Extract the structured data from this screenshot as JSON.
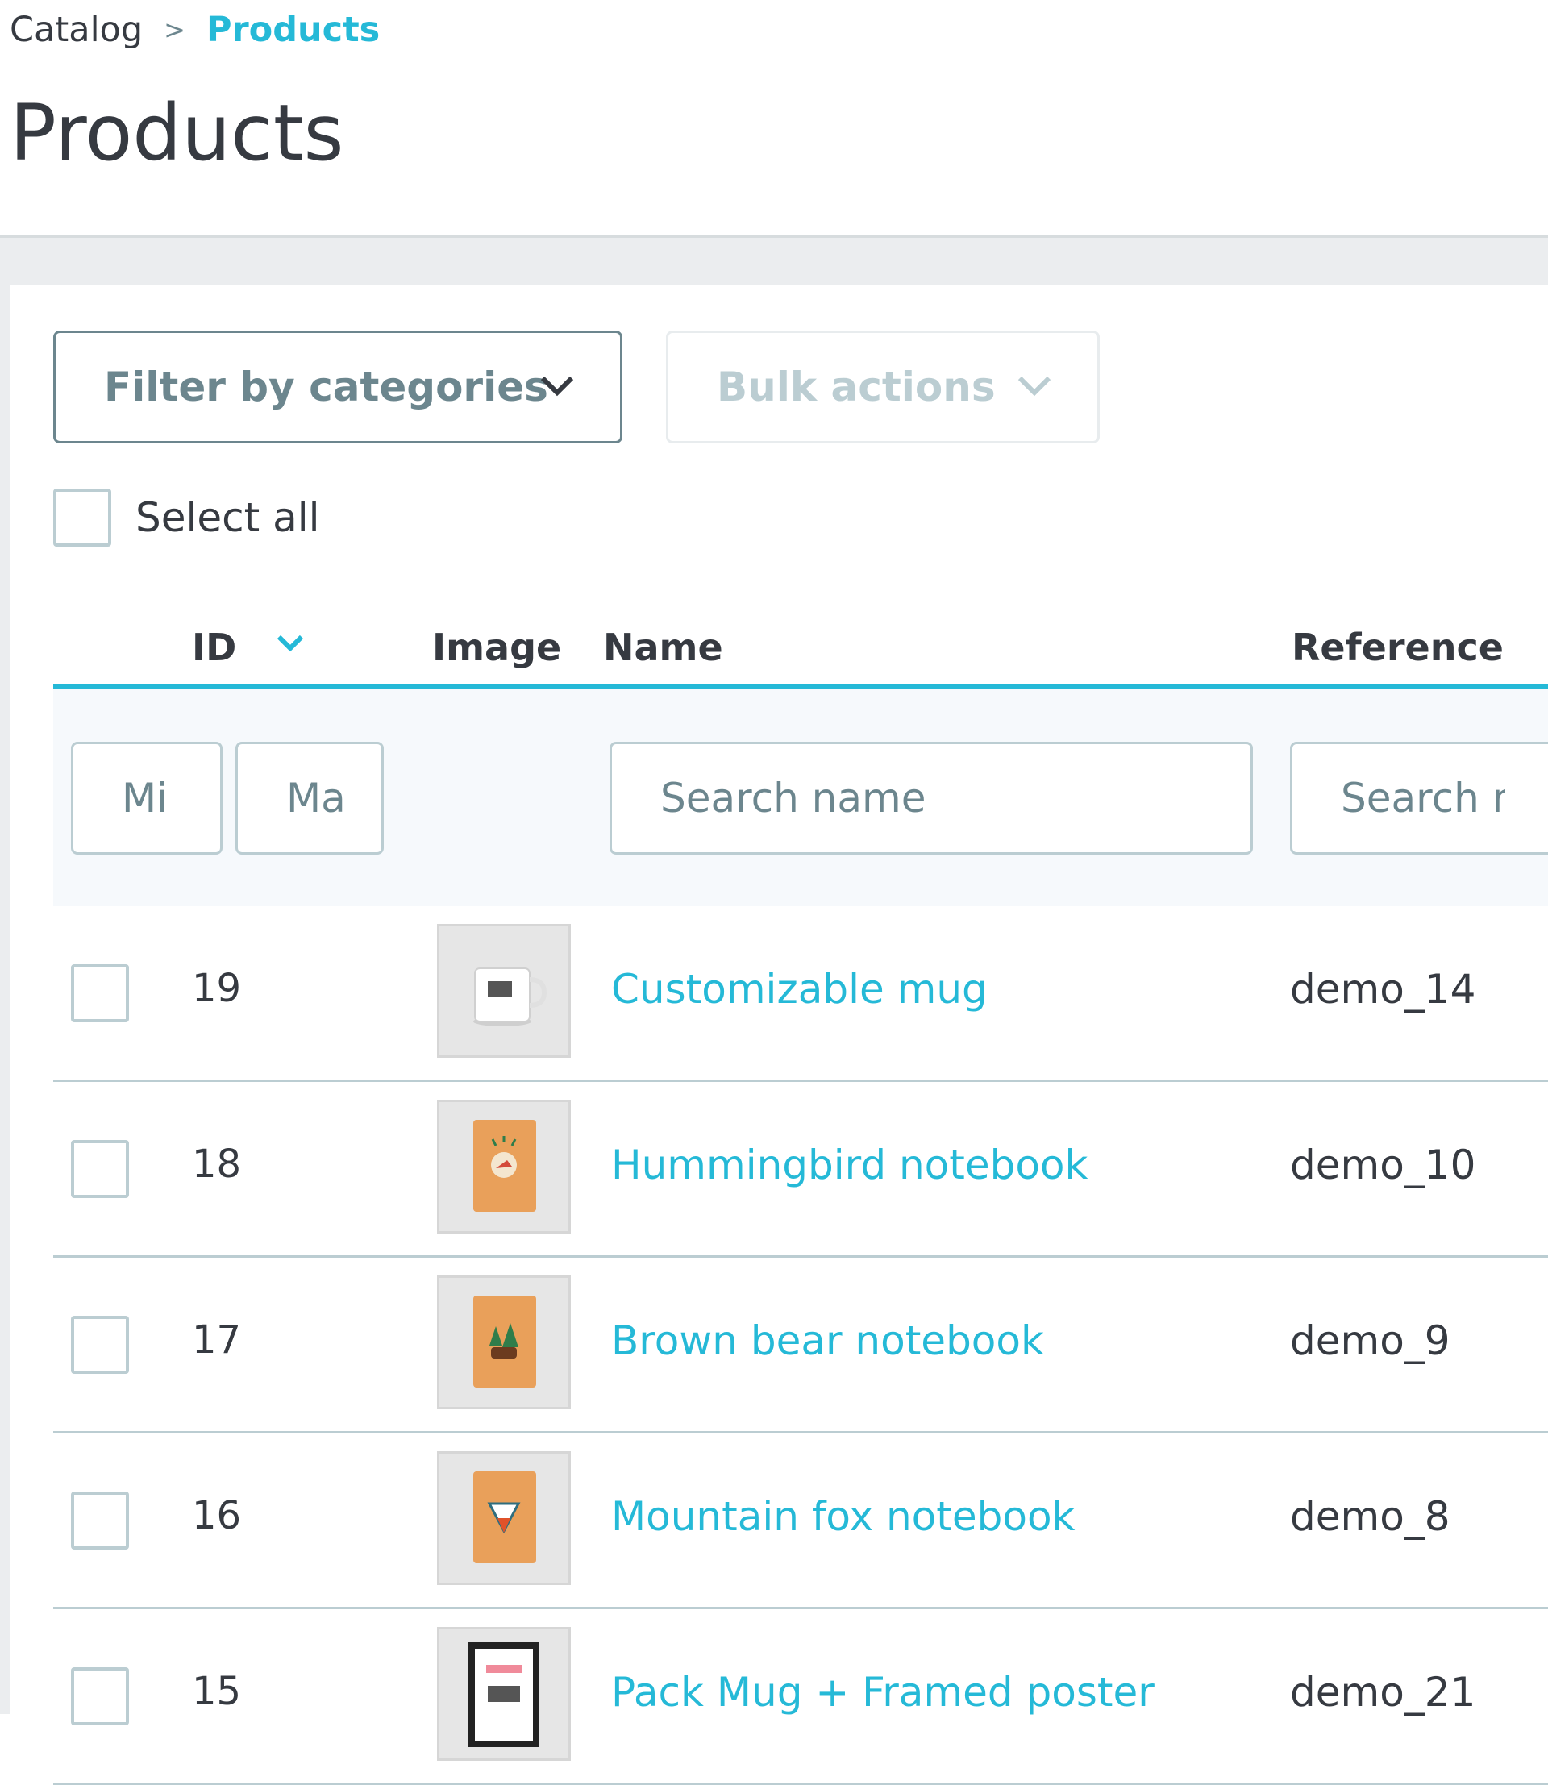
{
  "breadcrumb": {
    "parent": "Catalog",
    "separator": ">",
    "current": "Products"
  },
  "page": {
    "title": "Products"
  },
  "toolbar": {
    "filter_categories_label": "Filter by categories",
    "bulk_actions_label": "Bulk actions",
    "select_all_label": "Select all"
  },
  "table": {
    "columns": {
      "id": "ID",
      "image": "Image",
      "name": "Name",
      "reference": "Reference"
    },
    "filters": {
      "id_min_placeholder": "Mi",
      "id_max_placeholder": "Ma",
      "name_placeholder": "Search name",
      "reference_placeholder": "Search ref."
    },
    "rows": [
      {
        "id": "19",
        "image_icon": "mug-thumbnail",
        "name": "Customizable mug",
        "reference": "demo_14"
      },
      {
        "id": "18",
        "image_icon": "notebook-thumbnail",
        "name": "Hummingbird notebook",
        "reference": "demo_10"
      },
      {
        "id": "17",
        "image_icon": "notebook-thumbnail",
        "name": "Brown bear notebook",
        "reference": "demo_9"
      },
      {
        "id": "16",
        "image_icon": "notebook-thumbnail",
        "name": "Mountain fox notebook",
        "reference": "demo_8"
      },
      {
        "id": "15",
        "image_icon": "poster-thumbnail",
        "name": "Pack Mug + Framed poster",
        "reference": "demo_21"
      }
    ]
  },
  "colors": {
    "accent": "#25b9d7",
    "text": "#363a41",
    "muted": "#6c868e",
    "border": "#bbcdd2",
    "band": "#ebedef"
  }
}
